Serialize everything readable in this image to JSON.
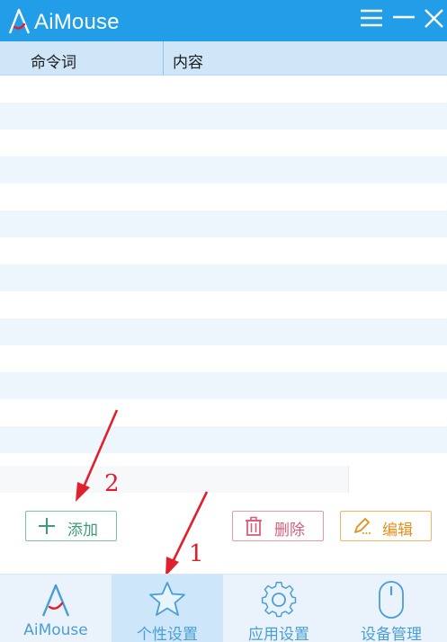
{
  "app": {
    "title": "AiMouse"
  },
  "window_controls": {
    "menu_icon": "hamburger-icon",
    "minimize_icon": "minimize-icon",
    "close_icon": "close-icon"
  },
  "table": {
    "columns": [
      "命令词",
      "内容"
    ],
    "rows": []
  },
  "actions": {
    "add_label": "添加",
    "delete_label": "删除",
    "edit_label": "编辑"
  },
  "annotations": {
    "arrow_1": "1",
    "arrow_2": "2"
  },
  "bottom_nav": {
    "items": [
      {
        "label": "AiMouse",
        "icon": "aimouse-logo-icon",
        "active": false
      },
      {
        "label": "个性设置",
        "icon": "star-icon",
        "active": true
      },
      {
        "label": "应用设置",
        "icon": "gear-icon",
        "active": false
      },
      {
        "label": "设备管理",
        "icon": "mouse-icon",
        "active": false
      }
    ]
  },
  "colors": {
    "titlebar": "#229ee8",
    "table_header": "#cfe6f8",
    "row_stripe": "#edf6fd",
    "add_accent": "#3c9c7a",
    "delete_accent": "#d85e7a",
    "edit_accent": "#e78e1c",
    "annotation": "#e0202c",
    "nav_text": "#4a9ed6"
  }
}
